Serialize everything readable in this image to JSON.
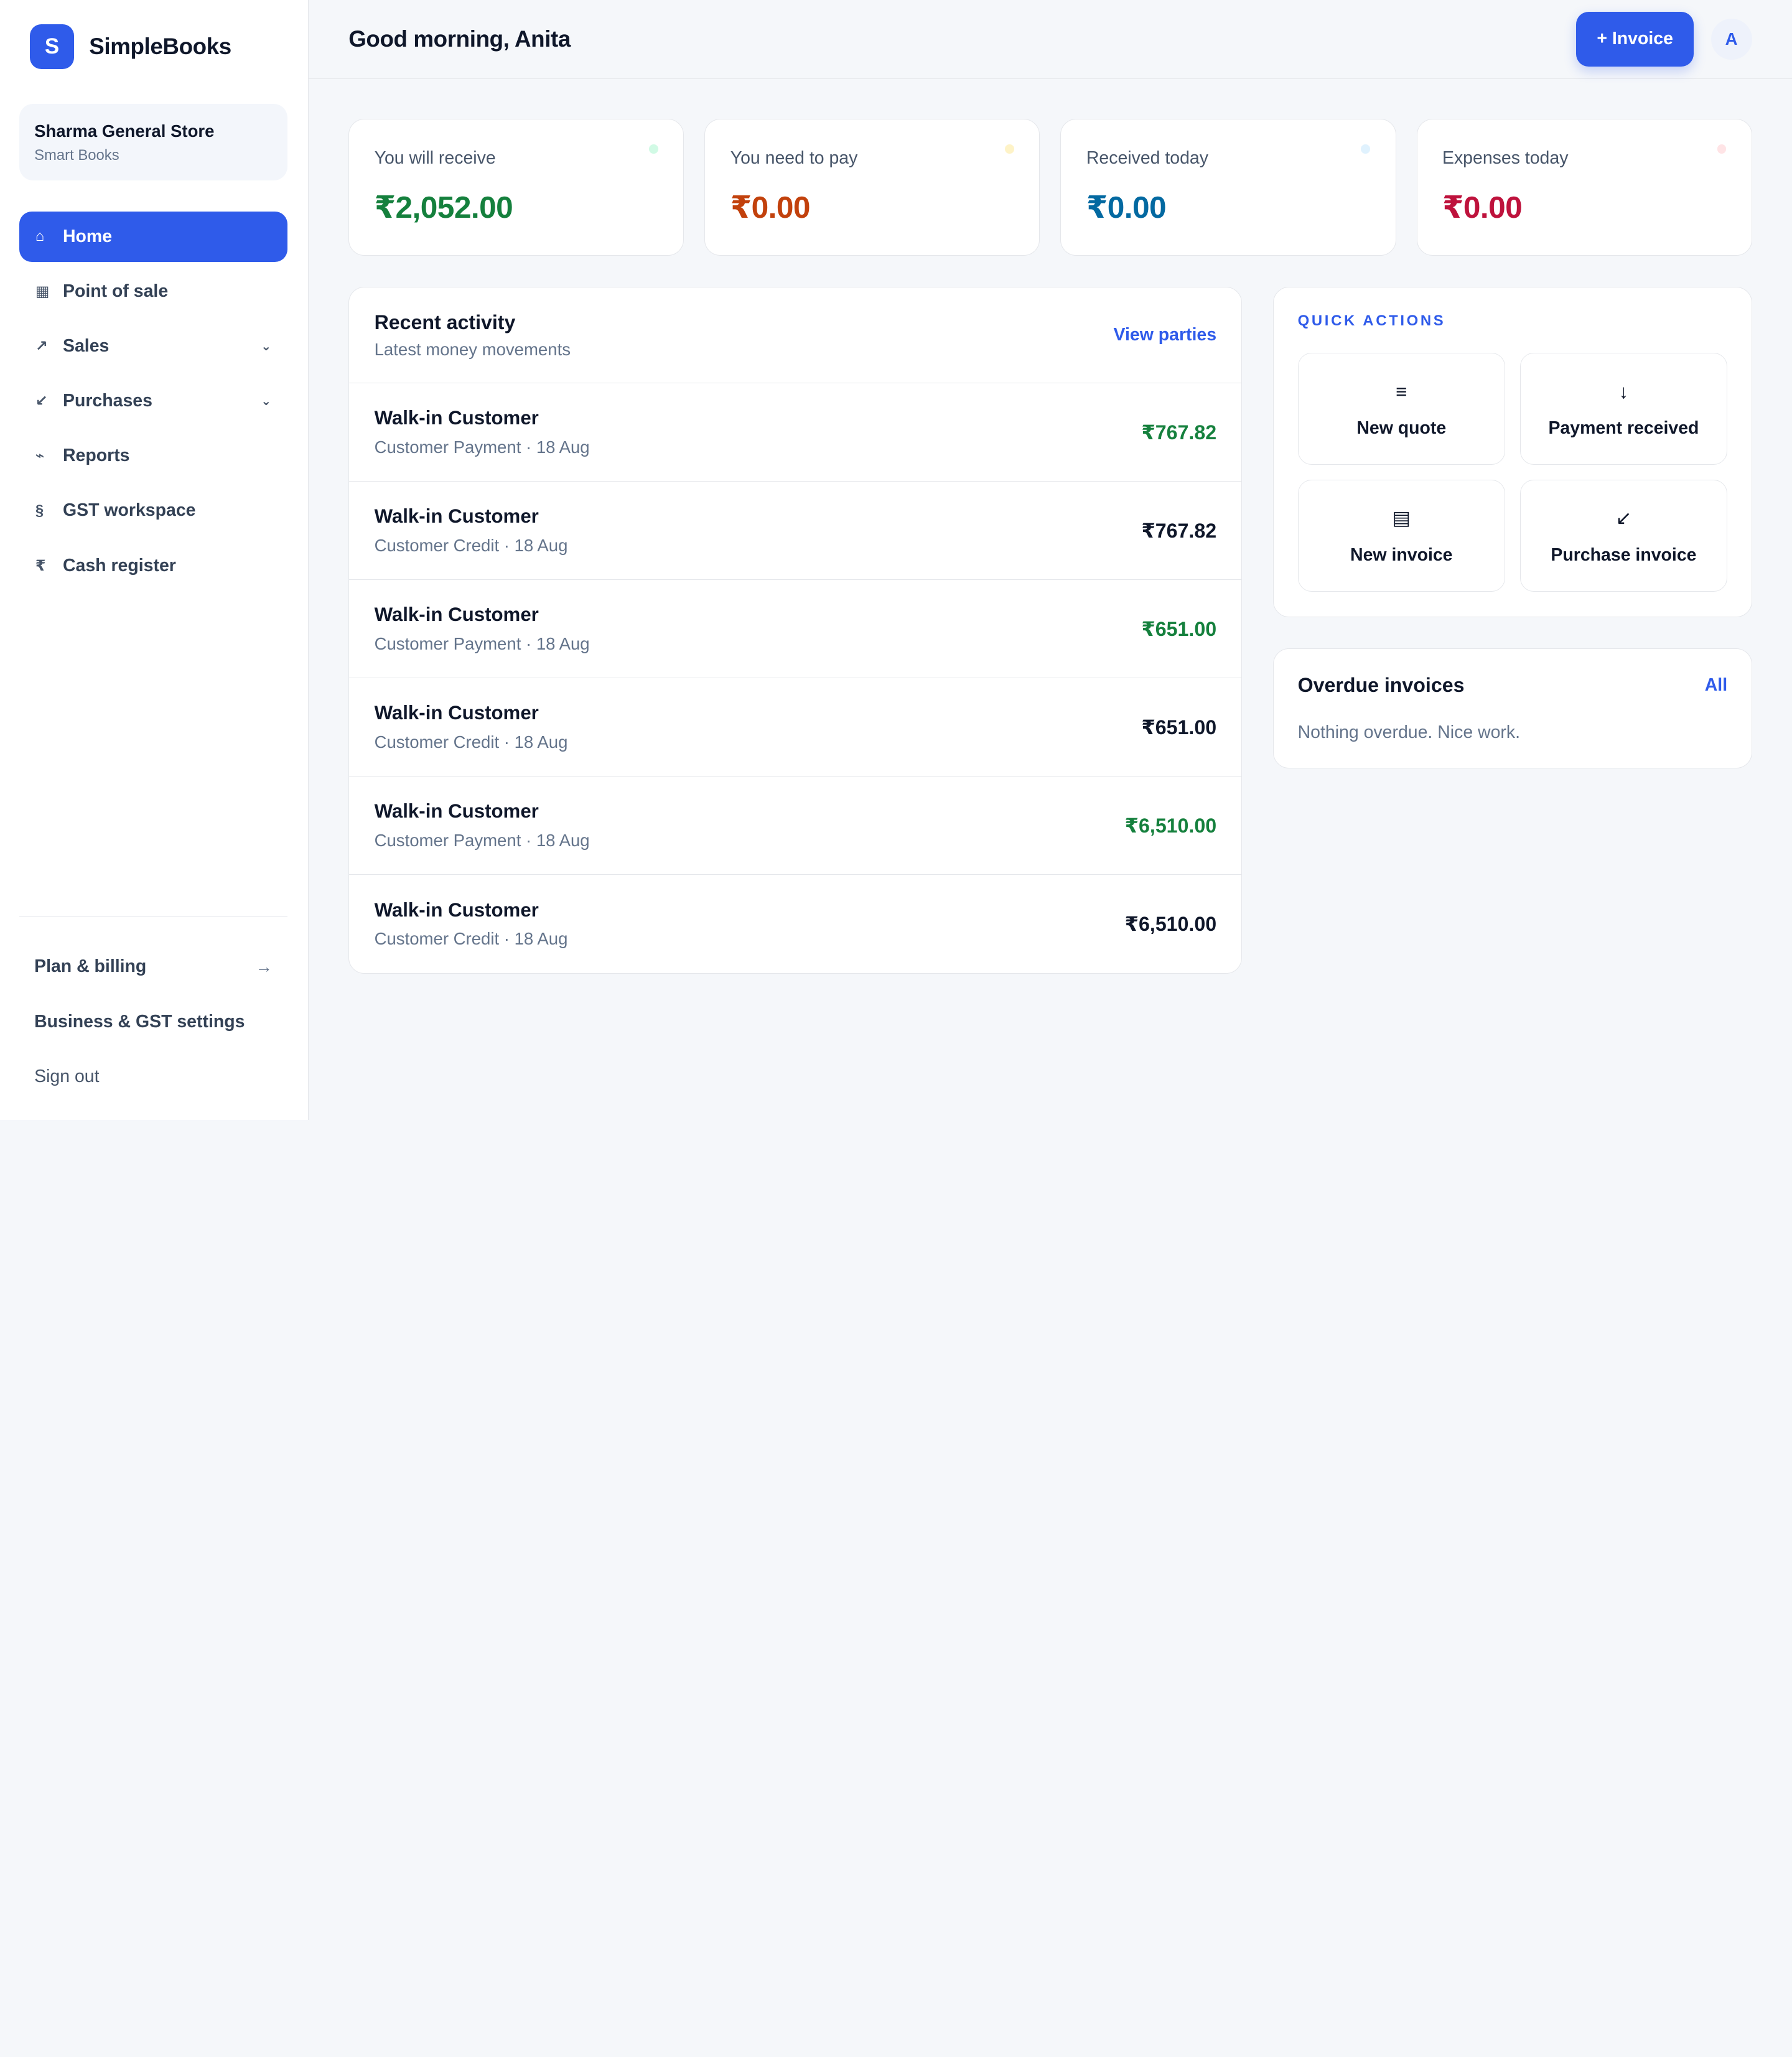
{
  "brand": {
    "logo_letter": "S",
    "name": "SimpleBooks"
  },
  "business": {
    "name": "Sharma General Store",
    "subtitle": "Smart Books"
  },
  "nav": [
    {
      "label": "Home",
      "icon": "home-icon",
      "glyph": "⌂",
      "active": true
    },
    {
      "label": "Point of sale",
      "icon": "pos-grid-icon",
      "glyph": "▦"
    },
    {
      "label": "Sales",
      "icon": "arrow-up-right-icon",
      "glyph": "↗",
      "chevron": "⌄"
    },
    {
      "label": "Purchases",
      "icon": "arrow-down-left-icon",
      "glyph": "↙",
      "chevron": "⌄"
    },
    {
      "label": "Reports",
      "icon": "chart-line-icon",
      "glyph": "⌁"
    },
    {
      "label": "GST workspace",
      "icon": "section-icon",
      "glyph": "§"
    },
    {
      "label": "Cash register",
      "icon": "rupee-icon",
      "glyph": "₹"
    }
  ],
  "bottom_nav": {
    "plan": "Plan & billing",
    "plan_arrow": "→",
    "settings": "Business & GST settings",
    "signout": "Sign out"
  },
  "header": {
    "greeting": "Good morning, Anita",
    "invoice_button": "+ Invoice",
    "avatar_letter": "A"
  },
  "stats": [
    {
      "label": "You will receive",
      "value": "₹2,052.00",
      "color": "#15803d",
      "dot": "#d1fae5"
    },
    {
      "label": "You need to pay",
      "value": "₹0.00",
      "color": "#c2410c",
      "dot": "#fef3c7"
    },
    {
      "label": "Received today",
      "value": "₹0.00",
      "color": "#0369a1",
      "dot": "#e0f2fe"
    },
    {
      "label": "Expenses today",
      "value": "₹0.00",
      "color": "#be123c",
      "dot": "#ffe4e6"
    }
  ],
  "activity": {
    "title": "Recent activity",
    "subtitle": "Latest money movements",
    "link": "View parties",
    "rows": [
      {
        "name": "Walk-in Customer",
        "meta": "Customer Payment · 18 Aug",
        "amount": "₹767.82",
        "tone": "green"
      },
      {
        "name": "Walk-in Customer",
        "meta": "Customer Credit · 18 Aug",
        "amount": "₹767.82",
        "tone": "dark"
      },
      {
        "name": "Walk-in Customer",
        "meta": "Customer Payment · 18 Aug",
        "amount": "₹651.00",
        "tone": "green"
      },
      {
        "name": "Walk-in Customer",
        "meta": "Customer Credit · 18 Aug",
        "amount": "₹651.00",
        "tone": "dark"
      },
      {
        "name": "Walk-in Customer",
        "meta": "Customer Payment · 18 Aug",
        "amount": "₹6,510.00",
        "tone": "green"
      },
      {
        "name": "Walk-in Customer",
        "meta": "Customer Credit · 18 Aug",
        "amount": "₹6,510.00",
        "tone": "dark"
      }
    ]
  },
  "quick_actions": {
    "title": "QUICK ACTIONS",
    "items": [
      {
        "label": "New quote",
        "icon": "list-icon",
        "glyph": "≡"
      },
      {
        "label": "Payment received",
        "icon": "arrow-down-icon",
        "glyph": "↓"
      },
      {
        "label": "New invoice",
        "icon": "invoice-icon",
        "glyph": "▤"
      },
      {
        "label": "Purchase invoice",
        "icon": "arrow-down-left-icon",
        "glyph": "↙"
      }
    ]
  },
  "overdue": {
    "title": "Overdue invoices",
    "link": "All",
    "message": "Nothing overdue. Nice work."
  },
  "colors": {
    "accent": "#2f5bea",
    "positive": "#15803d"
  }
}
